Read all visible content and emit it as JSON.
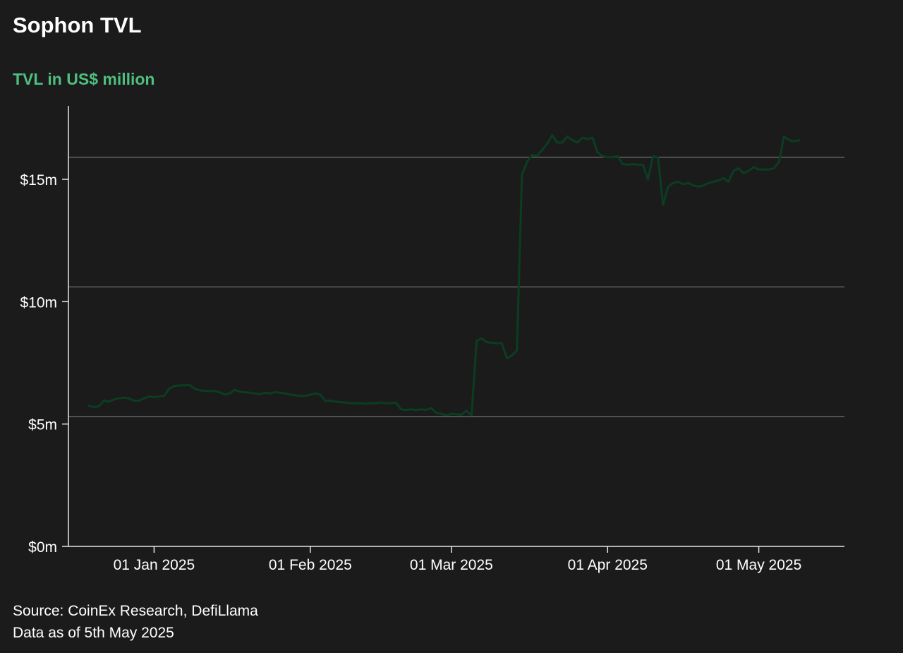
{
  "chart_data": {
    "type": "line",
    "title": "Sophon TVL",
    "subtitle": "TVL in US$ million",
    "ylabel": "",
    "xlabel": "",
    "ylim": [
      0,
      18
    ],
    "xlim": [
      "2024-12-15",
      "2025-05-18"
    ],
    "gridlines": [
      5.3,
      10.6,
      15.9
    ],
    "x_ticks": [
      {
        "date": "2025-01-01",
        "label": "01 Jan 2025"
      },
      {
        "date": "2025-02-01",
        "label": "01 Feb 2025"
      },
      {
        "date": "2025-03-01",
        "label": "01 Mar 2025"
      },
      {
        "date": "2025-04-01",
        "label": "01 Apr 2025"
      },
      {
        "date": "2025-05-01",
        "label": "01 May 2025"
      }
    ],
    "y_ticks": [
      {
        "value": 0,
        "label": "$0m"
      },
      {
        "value": 5,
        "label": "$5m"
      },
      {
        "value": 10,
        "label": "$10m"
      },
      {
        "value": 15,
        "label": "$15m"
      }
    ],
    "series": [
      {
        "color": "#0b3d22",
        "points": [
          [
            "2024-12-19",
            5.75
          ],
          [
            "2024-12-20",
            5.7
          ],
          [
            "2024-12-21",
            5.72
          ],
          [
            "2024-12-22",
            5.95
          ],
          [
            "2024-12-23",
            5.92
          ],
          [
            "2024-12-24",
            6.0
          ],
          [
            "2024-12-25",
            6.05
          ],
          [
            "2024-12-26",
            6.08
          ],
          [
            "2024-12-27",
            6.05
          ],
          [
            "2024-12-28",
            5.95
          ],
          [
            "2024-12-29",
            5.95
          ],
          [
            "2024-12-30",
            6.05
          ],
          [
            "2024-12-31",
            6.12
          ],
          [
            "2025-01-01",
            6.1
          ],
          [
            "2025-01-02",
            6.12
          ],
          [
            "2025-01-03",
            6.15
          ],
          [
            "2025-01-04",
            6.45
          ],
          [
            "2025-01-05",
            6.55
          ],
          [
            "2025-01-06",
            6.58
          ],
          [
            "2025-01-07",
            6.58
          ],
          [
            "2025-01-08",
            6.6
          ],
          [
            "2025-01-09",
            6.45
          ],
          [
            "2025-01-10",
            6.38
          ],
          [
            "2025-01-11",
            6.35
          ],
          [
            "2025-01-12",
            6.35
          ],
          [
            "2025-01-13",
            6.35
          ],
          [
            "2025-01-14",
            6.3
          ],
          [
            "2025-01-15",
            6.2
          ],
          [
            "2025-01-16",
            6.25
          ],
          [
            "2025-01-17",
            6.4
          ],
          [
            "2025-01-18",
            6.32
          ],
          [
            "2025-01-19",
            6.3
          ],
          [
            "2025-01-20",
            6.28
          ],
          [
            "2025-01-21",
            6.25
          ],
          [
            "2025-01-22",
            6.22
          ],
          [
            "2025-01-23",
            6.28
          ],
          [
            "2025-01-24",
            6.25
          ],
          [
            "2025-01-25",
            6.3
          ],
          [
            "2025-01-26",
            6.28
          ],
          [
            "2025-01-27",
            6.25
          ],
          [
            "2025-01-28",
            6.2
          ],
          [
            "2025-01-29",
            6.18
          ],
          [
            "2025-01-30",
            6.15
          ],
          [
            "2025-01-31",
            6.15
          ],
          [
            "2025-02-01",
            6.2
          ],
          [
            "2025-02-02",
            6.25
          ],
          [
            "2025-02-03",
            6.2
          ],
          [
            "2025-02-04",
            5.95
          ],
          [
            "2025-02-05",
            5.95
          ],
          [
            "2025-02-06",
            5.92
          ],
          [
            "2025-02-07",
            5.9
          ],
          [
            "2025-02-08",
            5.88
          ],
          [
            "2025-02-09",
            5.85
          ],
          [
            "2025-02-10",
            5.85
          ],
          [
            "2025-02-11",
            5.85
          ],
          [
            "2025-02-12",
            5.83
          ],
          [
            "2025-02-13",
            5.85
          ],
          [
            "2025-02-14",
            5.85
          ],
          [
            "2025-02-15",
            5.88
          ],
          [
            "2025-02-16",
            5.85
          ],
          [
            "2025-02-17",
            5.85
          ],
          [
            "2025-02-18",
            5.88
          ],
          [
            "2025-02-19",
            5.6
          ],
          [
            "2025-02-20",
            5.58
          ],
          [
            "2025-02-21",
            5.6
          ],
          [
            "2025-02-22",
            5.58
          ],
          [
            "2025-02-23",
            5.6
          ],
          [
            "2025-02-24",
            5.58
          ],
          [
            "2025-02-25",
            5.65
          ],
          [
            "2025-02-26",
            5.45
          ],
          [
            "2025-02-27",
            5.42
          ],
          [
            "2025-02-28",
            5.35
          ],
          [
            "2025-03-01",
            5.42
          ],
          [
            "2025-03-02",
            5.4
          ],
          [
            "2025-03-03",
            5.38
          ],
          [
            "2025-03-04",
            5.55
          ],
          [
            "2025-03-05",
            5.35
          ],
          [
            "2025-03-06",
            8.4
          ],
          [
            "2025-03-07",
            8.5
          ],
          [
            "2025-03-08",
            8.35
          ],
          [
            "2025-03-09",
            8.32
          ],
          [
            "2025-03-10",
            8.3
          ],
          [
            "2025-03-11",
            8.3
          ],
          [
            "2025-03-12",
            7.7
          ],
          [
            "2025-03-13",
            7.8
          ],
          [
            "2025-03-14",
            8.0
          ],
          [
            "2025-03-15",
            15.2
          ],
          [
            "2025-03-16",
            15.7
          ],
          [
            "2025-03-17",
            16.0
          ],
          [
            "2025-03-18",
            15.95
          ],
          [
            "2025-03-19",
            16.2
          ],
          [
            "2025-03-20",
            16.45
          ],
          [
            "2025-03-21",
            16.8
          ],
          [
            "2025-03-22",
            16.5
          ],
          [
            "2025-03-23",
            16.5
          ],
          [
            "2025-03-24",
            16.75
          ],
          [
            "2025-03-25",
            16.6
          ],
          [
            "2025-03-26",
            16.5
          ],
          [
            "2025-03-27",
            16.7
          ],
          [
            "2025-03-28",
            16.65
          ],
          [
            "2025-03-29",
            16.7
          ],
          [
            "2025-03-30",
            16.1
          ],
          [
            "2025-03-31",
            15.95
          ],
          [
            "2025-04-01",
            15.9
          ],
          [
            "2025-04-02",
            15.9
          ],
          [
            "2025-04-03",
            15.95
          ],
          [
            "2025-04-04",
            15.62
          ],
          [
            "2025-04-05",
            15.6
          ],
          [
            "2025-04-06",
            15.62
          ],
          [
            "2025-04-07",
            15.6
          ],
          [
            "2025-04-08",
            15.6
          ],
          [
            "2025-04-09",
            15.0
          ],
          [
            "2025-04-10",
            15.95
          ],
          [
            "2025-04-11",
            15.9
          ],
          [
            "2025-04-12",
            13.95
          ],
          [
            "2025-04-13",
            14.7
          ],
          [
            "2025-04-14",
            14.85
          ],
          [
            "2025-04-15",
            14.9
          ],
          [
            "2025-04-16",
            14.8
          ],
          [
            "2025-04-17",
            14.85
          ],
          [
            "2025-04-18",
            14.75
          ],
          [
            "2025-04-19",
            14.7
          ],
          [
            "2025-04-20",
            14.75
          ],
          [
            "2025-04-21",
            14.85
          ],
          [
            "2025-04-22",
            14.9
          ],
          [
            "2025-04-23",
            14.95
          ],
          [
            "2025-04-24",
            15.05
          ],
          [
            "2025-04-25",
            14.9
          ],
          [
            "2025-04-26",
            15.35
          ],
          [
            "2025-04-27",
            15.45
          ],
          [
            "2025-04-28",
            15.25
          ],
          [
            "2025-04-29",
            15.35
          ],
          [
            "2025-04-30",
            15.5
          ],
          [
            "2025-05-01",
            15.4
          ],
          [
            "2025-05-02",
            15.4
          ],
          [
            "2025-05-03",
            15.4
          ],
          [
            "2025-05-04",
            15.45
          ],
          [
            "2025-05-05",
            15.7
          ],
          [
            "2025-05-06",
            16.75
          ],
          [
            "2025-05-07",
            16.6
          ],
          [
            "2025-05-08",
            16.55
          ],
          [
            "2025-05-09",
            16.6
          ]
        ]
      }
    ]
  },
  "header": {
    "title": "Sophon TVL",
    "subtitle": "TVL in US$ million"
  },
  "footer": {
    "source": "Source: CoinEx Research, DefiLlama",
    "data_as_of": "Data as of 5th May 2025"
  },
  "colors": {
    "background": "#1b1b1b",
    "subtitle": "#4fbf7f",
    "line": "#0b3d22",
    "grid": "#8a8a8a",
    "axis": "#e6e6e6"
  }
}
